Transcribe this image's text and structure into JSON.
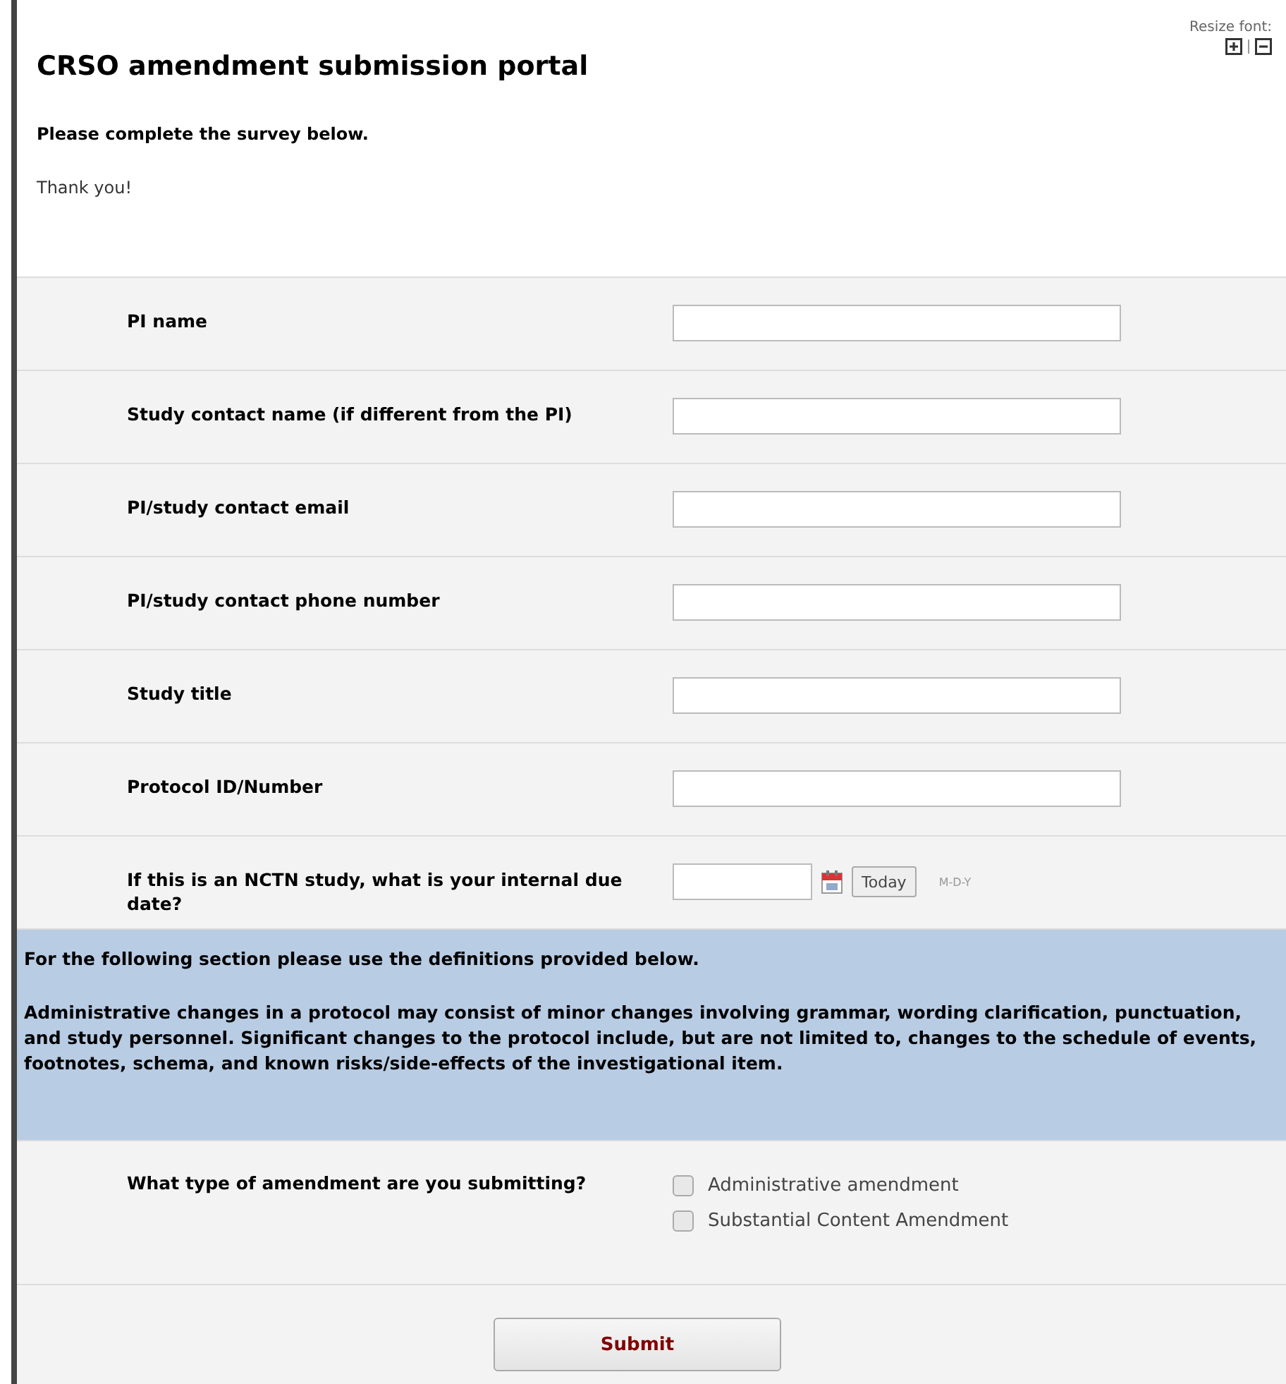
{
  "header": {
    "title": "CRSO amendment submission portal",
    "resize_label": "Resize font:",
    "intro": "Please complete the survey below.",
    "thanks": "Thank you!"
  },
  "fields": [
    {
      "kind": "text",
      "label": "PI name"
    },
    {
      "kind": "text",
      "label": "Study contact name (if different from the PI)"
    },
    {
      "kind": "text",
      "label": "PI/study contact email"
    },
    {
      "kind": "text",
      "label": "PI/study contact phone number"
    },
    {
      "kind": "text",
      "label": "Study title"
    },
    {
      "kind": "text",
      "label": "Protocol ID/Number"
    },
    {
      "kind": "date",
      "label": "If this is an NCTN study, what is your internal due date?",
      "button": "Today",
      "format": "M-D-Y"
    }
  ],
  "section": {
    "heading": "For the following section please use the definitions provided below.",
    "body": "Administrative changes in a protocol may consist of minor changes involving grammar, wording clarification, punctuation, and study personnel. Significant changes to the protocol include, but are not limited to, changes to the schedule of events, footnotes, schema, and known risks/side-effects of the investigational item."
  },
  "amendment": {
    "label": "What type of amendment are you submitting?",
    "options": [
      {
        "label": "Administrative amendment",
        "checked": false
      },
      {
        "label": "Substantial Content Amendment",
        "checked": false
      }
    ]
  },
  "submit": "Submit"
}
